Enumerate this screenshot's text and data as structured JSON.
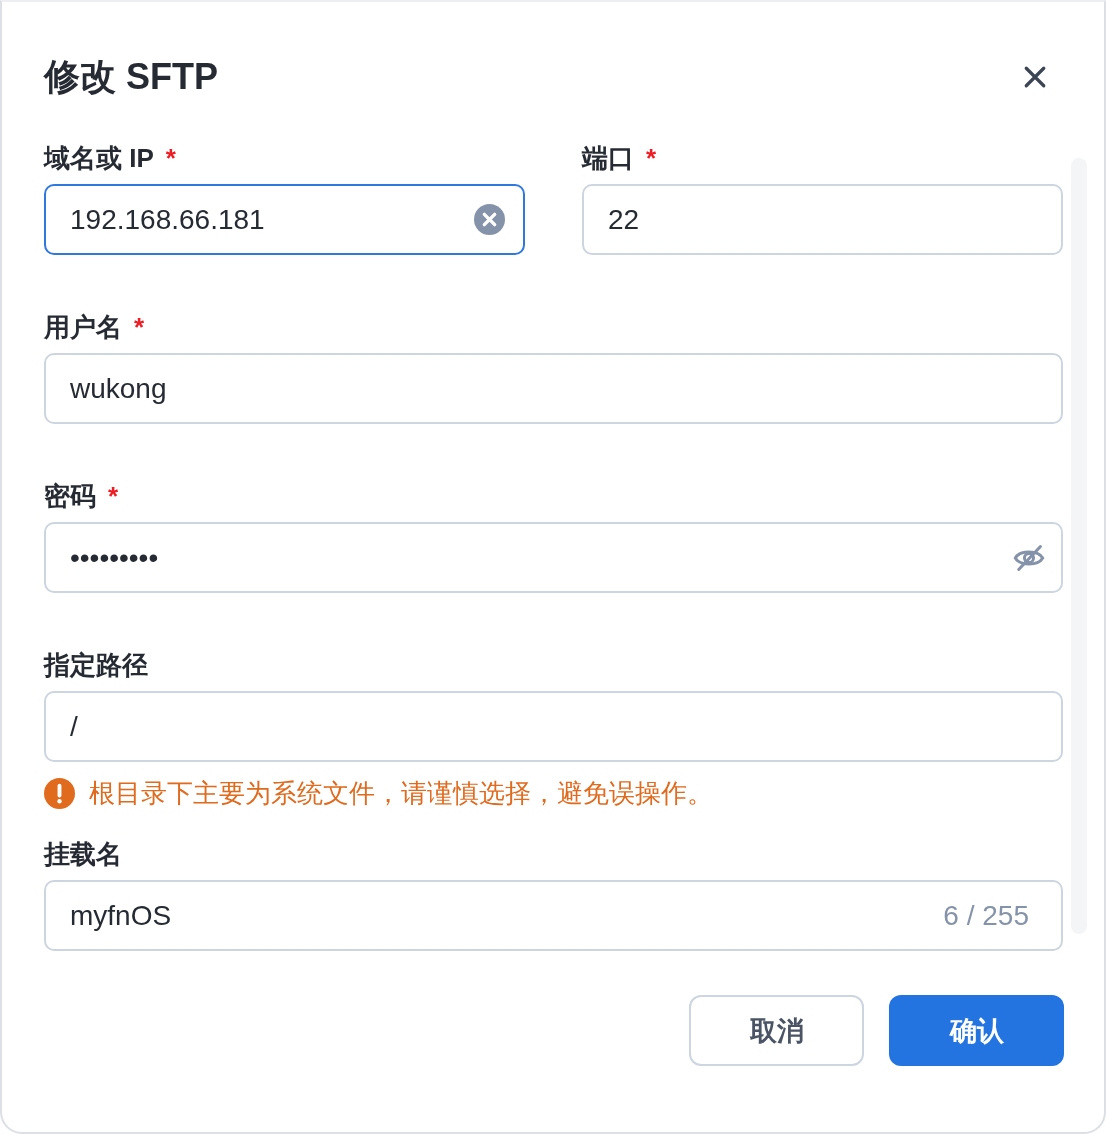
{
  "dialog": {
    "title": "修改 SFTP"
  },
  "rows": [
    [
      {
        "label": "域名或 IP",
        "required": true,
        "value": "192.168.66.181",
        "focused": true,
        "clearable": true
      },
      {
        "label": "端口",
        "required": true,
        "value": "22",
        "focused": false
      }
    ],
    [
      {
        "label": "用户名",
        "required": true,
        "value": "wukong",
        "focused": false
      }
    ],
    [
      {
        "label": "密码",
        "required": true,
        "value": "•••••••••",
        "focused": false,
        "visibility_toggle": true
      }
    ],
    [
      {
        "label": "指定路径",
        "required": false,
        "value": "/",
        "focused": false,
        "warning": "根目录下主要为系统文件，请谨慎选择，避免误操作。"
      }
    ],
    [
      {
        "label": "挂载名",
        "required": false,
        "value": "myfnOS",
        "focused": false,
        "counter": "6 / 255"
      }
    ]
  ],
  "required_mark": "*",
  "buttons": [
    {
      "label": "取消",
      "kind": "secondary"
    },
    {
      "label": "确认",
      "kind": "primary"
    }
  ]
}
